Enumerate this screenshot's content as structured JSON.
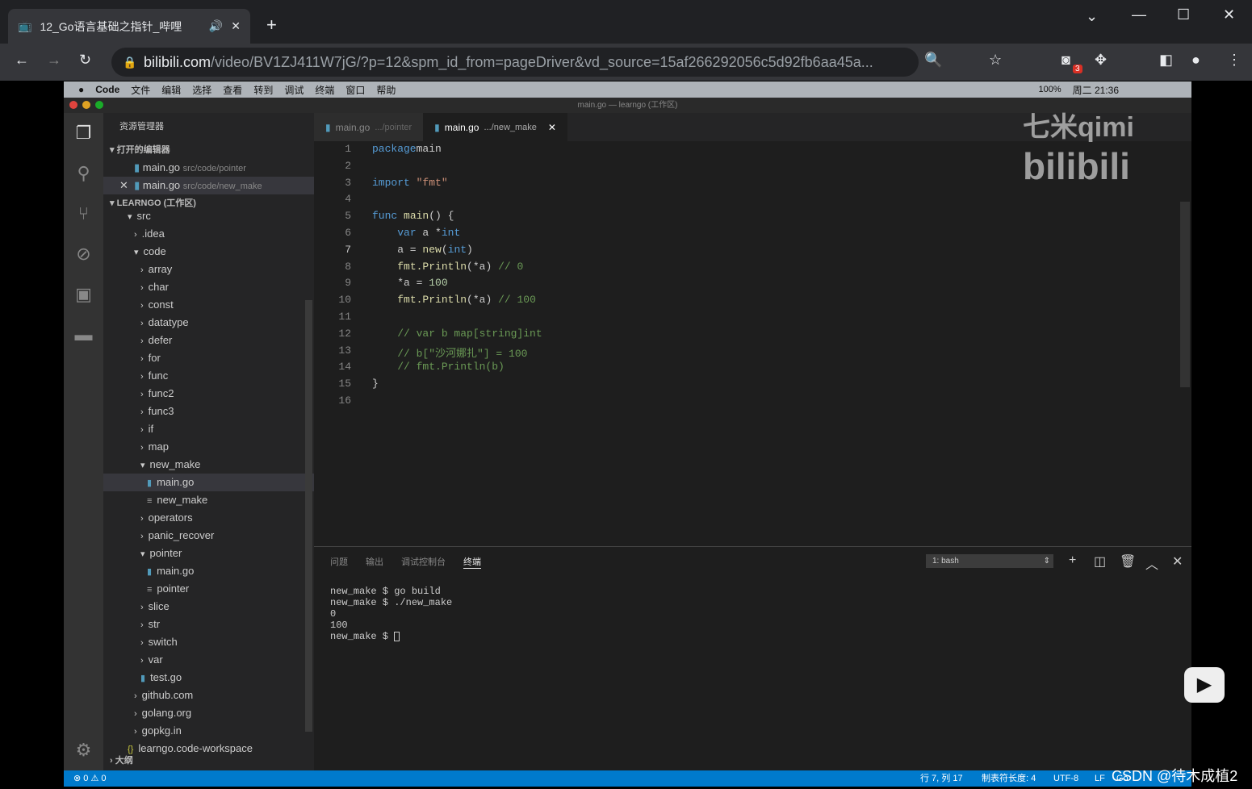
{
  "browser": {
    "tab_title": "12_Go语言基础之指针_哔哩",
    "url_host": "bilibili.com",
    "url_path": "/video/BV1ZJ411W7jG/?p=12&spm_id_from=pageDriver&vd_source=15af266292056c5d92fb6aa45a...",
    "ext_badge": "3"
  },
  "mac_menu": [
    "Code",
    "文件",
    "编辑",
    "选择",
    "查看",
    "转到",
    "调试",
    "终端",
    "窗口",
    "帮助"
  ],
  "mac_status": {
    "battery": "100%",
    "clock": "周二 21:36"
  },
  "window_title": "main.go — learngo (工作区)",
  "sidebar": {
    "header": "资源管理器",
    "open_editors": "打开的编辑器",
    "open_files": [
      {
        "name": "main.go",
        "path": "src/code/pointer"
      },
      {
        "name": "main.go",
        "path": "src/code/new_make"
      }
    ],
    "workspace": "LEARNGO (工作区)",
    "tree": [
      {
        "label": "src",
        "d": 1,
        "t": "open"
      },
      {
        "label": ".idea",
        "d": 2,
        "t": "closed"
      },
      {
        "label": "code",
        "d": 2,
        "t": "open"
      },
      {
        "label": "array",
        "d": 3,
        "t": "closed"
      },
      {
        "label": "char",
        "d": 3,
        "t": "closed"
      },
      {
        "label": "const",
        "d": 3,
        "t": "closed"
      },
      {
        "label": "datatype",
        "d": 3,
        "t": "closed"
      },
      {
        "label": "defer",
        "d": 3,
        "t": "closed"
      },
      {
        "label": "for",
        "d": 3,
        "t": "closed"
      },
      {
        "label": "func",
        "d": 3,
        "t": "closed"
      },
      {
        "label": "func2",
        "d": 3,
        "t": "closed"
      },
      {
        "label": "func3",
        "d": 3,
        "t": "closed"
      },
      {
        "label": "if",
        "d": 3,
        "t": "closed"
      },
      {
        "label": "map",
        "d": 3,
        "t": "closed"
      },
      {
        "label": "new_make",
        "d": 3,
        "t": "open"
      },
      {
        "label": "main.go",
        "d": 4,
        "t": "go",
        "sel": true
      },
      {
        "label": "new_make",
        "d": 4,
        "t": "bin"
      },
      {
        "label": "operators",
        "d": 3,
        "t": "closed"
      },
      {
        "label": "panic_recover",
        "d": 3,
        "t": "closed"
      },
      {
        "label": "pointer",
        "d": 3,
        "t": "open"
      },
      {
        "label": "main.go",
        "d": 4,
        "t": "go"
      },
      {
        "label": "pointer",
        "d": 4,
        "t": "bin"
      },
      {
        "label": "slice",
        "d": 3,
        "t": "closed"
      },
      {
        "label": "str",
        "d": 3,
        "t": "closed"
      },
      {
        "label": "switch",
        "d": 3,
        "t": "closed"
      },
      {
        "label": "var",
        "d": 3,
        "t": "closed"
      },
      {
        "label": "test.go",
        "d": 3,
        "t": "go"
      },
      {
        "label": "github.com",
        "d": 2,
        "t": "closed"
      },
      {
        "label": "golang.org",
        "d": 2,
        "t": "closed"
      },
      {
        "label": "gopkg.in",
        "d": 2,
        "t": "closed"
      },
      {
        "label": "learngo.code-workspace",
        "d": 1,
        "t": "json"
      }
    ],
    "outline": "大纲"
  },
  "editor": {
    "tabs": [
      {
        "name": "main.go",
        "path": ".../pointer"
      },
      {
        "name": "main.go",
        "path": ".../new_make"
      }
    ],
    "lines": [
      [
        [
          "kw",
          "package"
        ],
        [
          "",
          "main"
        ]
      ],
      [],
      [
        [
          "kw",
          "import"
        ],
        [
          "",
          ""
        ],
        [
          "st",
          "\"fmt\""
        ]
      ],
      [],
      [
        [
          "kw",
          "func"
        ],
        [
          "fn",
          " main"
        ],
        [
          "",
          "() {"
        ]
      ],
      [
        [
          "",
          "    "
        ],
        [
          "kw",
          "var"
        ],
        [
          "",
          " a *"
        ],
        [
          "kw",
          "int"
        ]
      ],
      [
        [
          "",
          "    a = "
        ],
        [
          "fn",
          "new"
        ],
        [
          "",
          "("
        ],
        [
          "kw",
          "int"
        ],
        [
          "",
          ")"
        ]
      ],
      [
        [
          "",
          "    "
        ],
        [
          "fn",
          "fmt.Println"
        ],
        [
          "",
          "(*a) "
        ],
        [
          "cm",
          "// 0"
        ]
      ],
      [
        [
          "",
          "    *a = "
        ],
        [
          "nu",
          "100"
        ]
      ],
      [
        [
          "",
          "    "
        ],
        [
          "fn",
          "fmt.Println"
        ],
        [
          "",
          "(*a) "
        ],
        [
          "cm",
          "// 100"
        ]
      ],
      [],
      [
        [
          "cm",
          "    // var b map[string]int"
        ]
      ],
      [
        [
          "cm",
          "    // b[\"沙河娜扎\"] = 100"
        ]
      ],
      [
        [
          "cm",
          "    // fmt.Println(b)"
        ]
      ],
      [
        [
          "",
          "}"
        ]
      ],
      []
    ]
  },
  "panel": {
    "tabs": [
      "问题",
      "输出",
      "调试控制台",
      "终端"
    ],
    "shell": "1: bash",
    "terminal": "new_make $ go build\nnew_make $ ./new_make\n0\n100\nnew_make $ "
  },
  "status": {
    "errors": "0",
    "warnings": "0",
    "position": "行 7, 列 17",
    "tab": "制表符长度: 4",
    "enc": "UTF-8",
    "eol": "LF",
    "lang": "Go"
  },
  "watermark": {
    "logo": "七米qimi bilibili",
    "csdn": "CSDN @待木成植2"
  }
}
